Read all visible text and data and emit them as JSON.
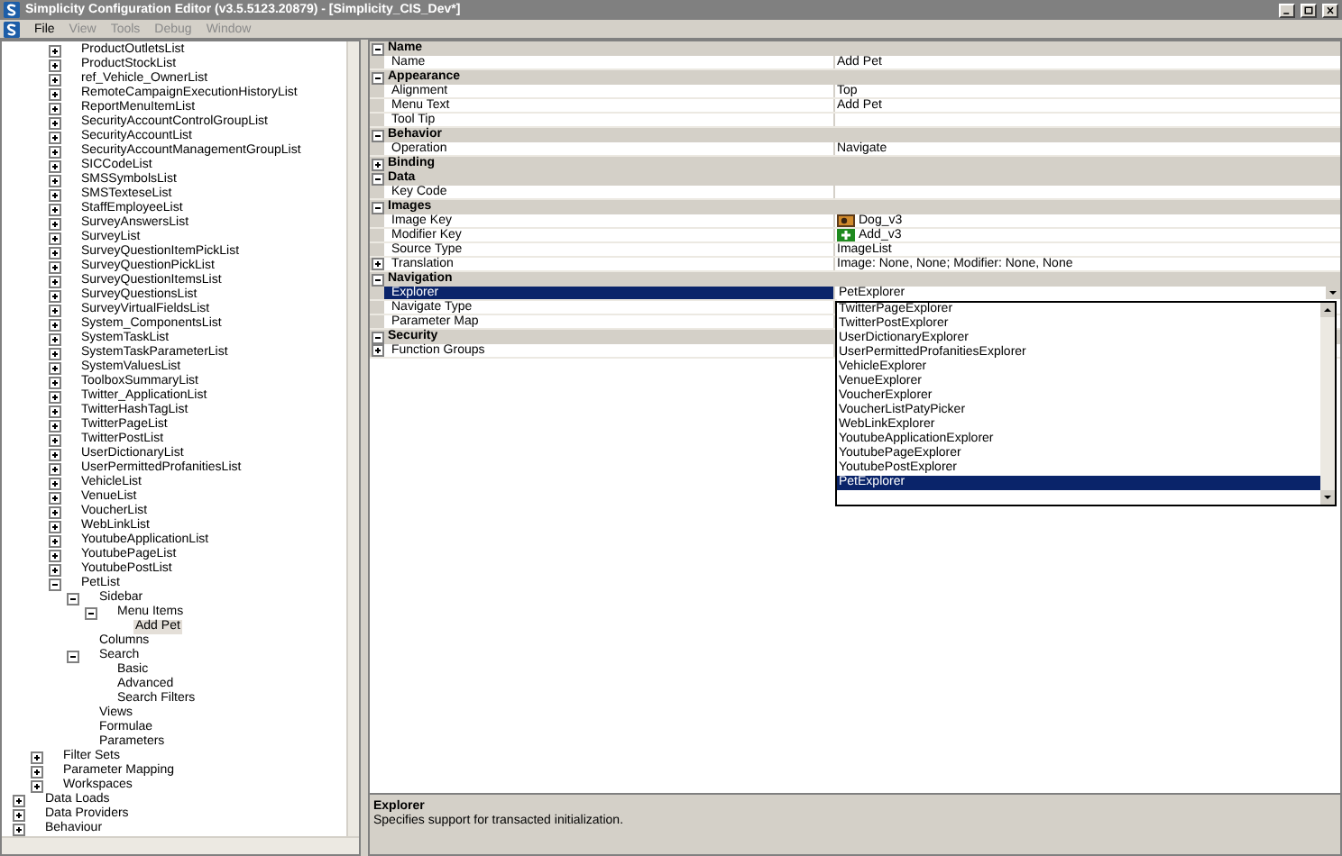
{
  "window": {
    "title": "Simplicity Configuration Editor (v3.5.5123.20879) - [Simplicity_CIS_Dev*]"
  },
  "menu": [
    {
      "label": "File",
      "disabled": false
    },
    {
      "label": "View",
      "disabled": true
    },
    {
      "label": "Tools",
      "disabled": true
    },
    {
      "label": "Debug",
      "disabled": true
    },
    {
      "label": "Window",
      "disabled": true
    }
  ],
  "tree": {
    "items": [
      {
        "children": [
          {
            "children": [
              {
                "label": "ProductOutletsList",
                "expanded": false,
                "selected": false
              },
              {
                "label": "ProductStockList",
                "expanded": false,
                "selected": false
              },
              {
                "label": "ref_Vehicle_OwnerList",
                "expanded": false,
                "selected": false
              },
              {
                "label": "RemoteCampaignExecutionHistoryList",
                "expanded": false,
                "selected": false
              },
              {
                "label": "ReportMenuItemList",
                "expanded": false,
                "selected": false
              },
              {
                "label": "SecurityAccountControlGroupList",
                "expanded": false,
                "selected": false
              },
              {
                "label": "SecurityAccountList",
                "expanded": false,
                "selected": false
              },
              {
                "label": "SecurityAccountManagementGroupList",
                "expanded": false,
                "selected": false
              },
              {
                "label": "SICCodeList",
                "expanded": false,
                "selected": false
              },
              {
                "label": "SMSSymbolsList",
                "expanded": false,
                "selected": false
              },
              {
                "label": "SMSTexteseList",
                "expanded": false,
                "selected": false
              },
              {
                "label": "StaffEmployeeList",
                "expanded": false,
                "selected": false
              },
              {
                "label": "SurveyAnswersList",
                "expanded": false,
                "selected": false
              },
              {
                "label": "SurveyList",
                "expanded": false,
                "selected": false
              },
              {
                "label": "SurveyQuestionItemPickList",
                "expanded": false,
                "selected": false
              },
              {
                "label": "SurveyQuestionPickList",
                "expanded": false,
                "selected": false
              },
              {
                "label": "SurveyQuestionItemsList",
                "expanded": false,
                "selected": false
              },
              {
                "label": "SurveyQuestionsList",
                "expanded": false,
                "selected": false
              },
              {
                "label": "SurveyVirtualFieldsList",
                "expanded": false,
                "selected": false
              },
              {
                "label": "System_ComponentsList",
                "expanded": false,
                "selected": false
              },
              {
                "label": "SystemTaskList",
                "expanded": false,
                "selected": false
              },
              {
                "label": "SystemTaskParameterList",
                "expanded": false,
                "selected": false
              },
              {
                "label": "SystemValuesList",
                "expanded": false,
                "selected": false
              },
              {
                "label": "ToolboxSummaryList",
                "expanded": false,
                "selected": false
              },
              {
                "label": "Twitter_ApplicationList",
                "expanded": false,
                "selected": false
              },
              {
                "label": "TwitterHashTagList",
                "expanded": false,
                "selected": false
              },
              {
                "label": "TwitterPageList",
                "expanded": false,
                "selected": false
              },
              {
                "label": "TwitterPostList",
                "expanded": false,
                "selected": false
              },
              {
                "label": "UserDictionaryList",
                "expanded": false,
                "selected": false
              },
              {
                "label": "UserPermittedProfanitiesList",
                "expanded": false,
                "selected": false
              },
              {
                "label": "VehicleList",
                "expanded": false,
                "selected": false
              },
              {
                "label": "VenueList",
                "expanded": false,
                "selected": false
              },
              {
                "label": "VoucherList",
                "expanded": false,
                "selected": false
              },
              {
                "label": "WebLinkList",
                "expanded": false,
                "selected": false
              },
              {
                "label": "YoutubeApplicationList",
                "expanded": false,
                "selected": false
              },
              {
                "label": "YoutubePageList",
                "expanded": false,
                "selected": false
              },
              {
                "label": "YoutubePostList",
                "expanded": false,
                "selected": false
              },
              {
                "label": "PetList",
                "expanded": true,
                "selected": false,
                "children": [
                  {
                    "label": "Sidebar",
                    "expanded": true,
                    "selected": false,
                    "children": [
                      {
                        "label": "Menu Items",
                        "expanded": true,
                        "selected": false,
                        "children": [
                          {
                            "label": "Add Pet",
                            "selected": true
                          }
                        ]
                      }
                    ]
                  },
                  {
                    "label": "Columns",
                    "selected": false
                  },
                  {
                    "label": "Search",
                    "expanded": true,
                    "selected": false,
                    "children": [
                      {
                        "label": "Basic",
                        "selected": false
                      },
                      {
                        "label": "Advanced",
                        "selected": false
                      },
                      {
                        "label": "Search Filters",
                        "selected": false
                      }
                    ]
                  },
                  {
                    "label": "Views",
                    "selected": false
                  },
                  {
                    "label": "Formulae",
                    "selected": false
                  },
                  {
                    "label": "Parameters",
                    "selected": false
                  }
                ]
              }
            ]
          },
          {
            "label": "Filter Sets",
            "expanded": false,
            "selected": false
          },
          {
            "label": "Parameter Mapping",
            "expanded": false,
            "selected": false
          },
          {
            "label": "Workspaces",
            "expanded": false,
            "selected": false
          }
        ]
      },
      {
        "label": "Data Loads",
        "expanded": false,
        "selected": false
      },
      {
        "label": "Data Providers",
        "expanded": false,
        "selected": false
      },
      {
        "label": "Behaviour",
        "expanded": false,
        "selected": false
      }
    ]
  },
  "properties": {
    "categories": [
      {
        "label": "Name",
        "expanded": true,
        "rows": [
          {
            "name": "Name",
            "value": "Add Pet",
            "selected": false
          }
        ]
      },
      {
        "label": "Appearance",
        "expanded": true,
        "rows": [
          {
            "name": "Alignment",
            "value": "Top",
            "selected": false
          },
          {
            "name": "Menu Text",
            "value": "Add Pet",
            "selected": false
          },
          {
            "name": "Tool Tip",
            "selected": false
          }
        ]
      },
      {
        "label": "Behavior",
        "expanded": true,
        "rows": [
          {
            "name": "Operation",
            "value": "Navigate",
            "selected": false
          }
        ]
      },
      {
        "label": "Binding",
        "expanded": false
      },
      {
        "label": "Data",
        "expanded": true,
        "rows": [
          {
            "name": "Key Code",
            "selected": false
          }
        ]
      },
      {
        "label": "Images",
        "expanded": true,
        "rows": [
          {
            "name": "Image Key",
            "value": "Dog_v3",
            "kind": "picture",
            "selected": false
          },
          {
            "name": "Modifier Key",
            "value": "Add_v3",
            "kind": "plus",
            "selected": false
          },
          {
            "name": "Source Type",
            "value": "ImageList",
            "selected": false
          },
          {
            "name": "Translation",
            "value": "Image: None, None; Modifier: None, None",
            "expanded": false,
            "selected": false
          }
        ]
      },
      {
        "label": "Navigation",
        "expanded": true,
        "rows": [
          {
            "name": "Explorer",
            "value": "PetExplorer",
            "kind": "dropdown",
            "selected": true
          },
          {
            "name": "Navigate Type",
            "selected": false
          },
          {
            "name": "Parameter Map",
            "selected": false
          }
        ]
      },
      {
        "label": "Security",
        "expanded": true,
        "rows": [
          {
            "name": "Function Groups",
            "expanded": false,
            "selected": false
          }
        ]
      }
    ]
  },
  "explorer_dropdown": {
    "options": [
      {
        "label": "TwitterPageExplorer",
        "selected": false
      },
      {
        "label": "TwitterPostExplorer",
        "selected": false
      },
      {
        "label": "UserDictionaryExplorer",
        "selected": false
      },
      {
        "label": "UserPermittedProfanitiesExplorer",
        "selected": false
      },
      {
        "label": "VehicleExplorer",
        "selected": false
      },
      {
        "label": "VenueExplorer",
        "selected": false
      },
      {
        "label": "VoucherExplorer",
        "selected": false
      },
      {
        "label": "VoucherListPatyPicker",
        "selected": false
      },
      {
        "label": "WebLinkExplorer",
        "selected": false
      },
      {
        "label": "YoutubeApplicationExplorer",
        "selected": false
      },
      {
        "label": "YoutubePageExplorer",
        "selected": false
      },
      {
        "label": "YoutubePostExplorer",
        "selected": false
      },
      {
        "label": "PetExplorer",
        "selected": true
      }
    ]
  },
  "description": {
    "title": "Explorer",
    "text": "Specifies support for transacted initialization."
  }
}
